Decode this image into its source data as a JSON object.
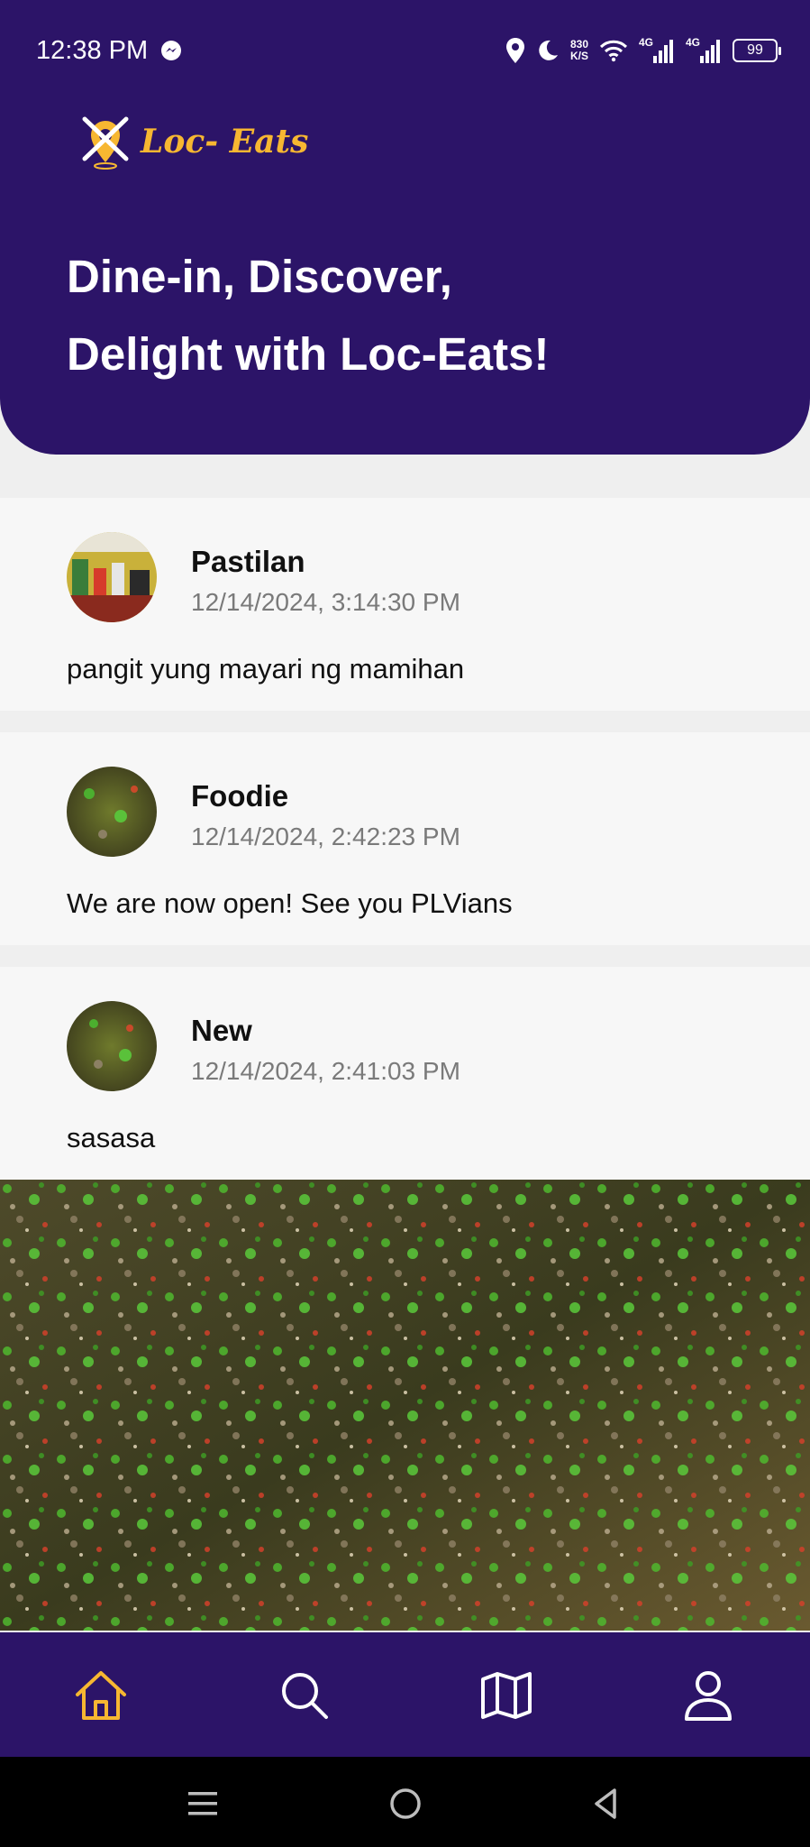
{
  "status_bar": {
    "time": "12:38 PM",
    "net_speed_value": "830",
    "net_speed_unit": "K/S",
    "signal1_label": "4G",
    "signal2_label": "4G",
    "battery": "99"
  },
  "brand": {
    "name": "Loc- Eats",
    "accent_color": "#f7b731",
    "primary_color": "#2c1468"
  },
  "hero": {
    "line1": "Dine-in, Discover,",
    "line2": "Delight with Loc-Eats!"
  },
  "posts": [
    {
      "author": "Pastilan",
      "timestamp": "12/14/2024, 3:14:30 PM",
      "text": "pangit yung mayari ng mamihan"
    },
    {
      "author": "Foodie",
      "timestamp": "12/14/2024, 2:42:23 PM",
      "text": "We are now open! See you PLVians"
    },
    {
      "author": "New",
      "timestamp": "12/14/2024, 2:41:03 PM",
      "text": "sasasa"
    }
  ],
  "bottom_nav": {
    "items": [
      {
        "icon": "home-icon",
        "active": true
      },
      {
        "icon": "search-icon",
        "active": false
      },
      {
        "icon": "map-icon",
        "active": false
      },
      {
        "icon": "profile-icon",
        "active": false
      }
    ],
    "active_color": "#f7b731",
    "inactive_color": "#ffffff"
  },
  "system_nav": [
    "menu-icon",
    "home-circle-icon",
    "back-icon"
  ]
}
